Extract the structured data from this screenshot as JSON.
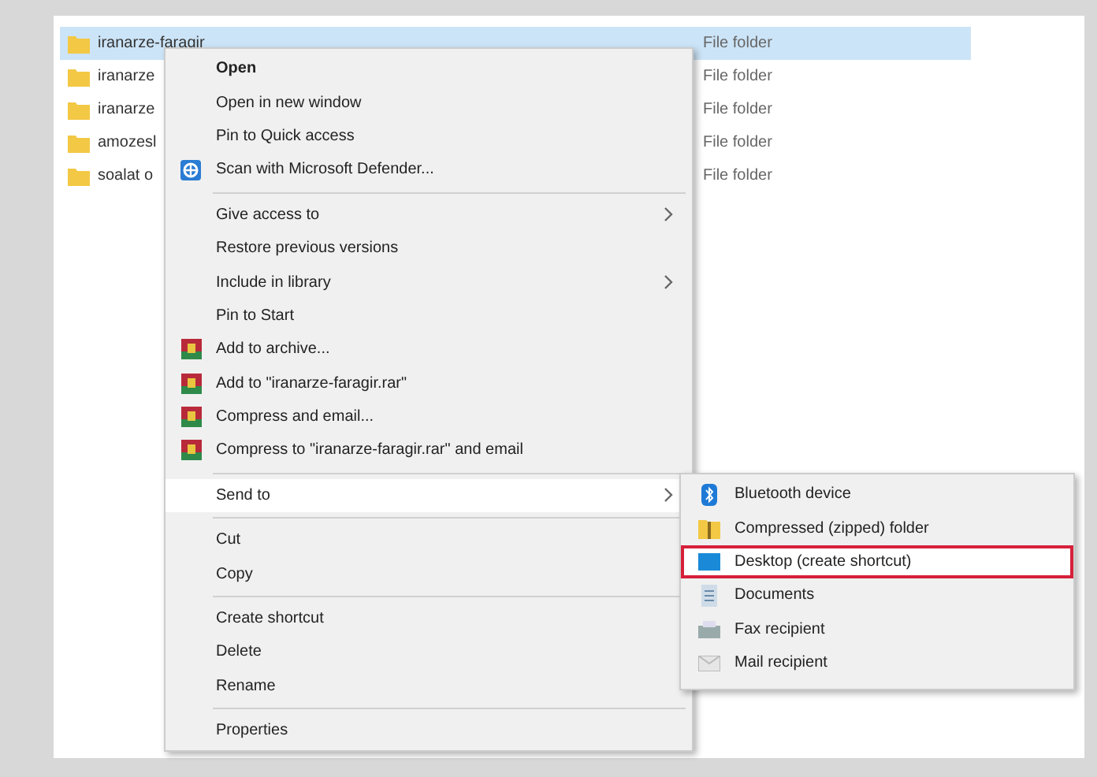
{
  "file_list": {
    "rows": [
      {
        "name": "iranarze-faragir",
        "type": "File folder",
        "selected": true
      },
      {
        "name": "iranarze",
        "type": "File folder",
        "selected": false
      },
      {
        "name": "iranarze",
        "type": "File folder",
        "selected": false
      },
      {
        "name": "amozesl",
        "type": "File folder",
        "selected": false
      },
      {
        "name": "soalat o",
        "type": "File folder",
        "selected": false
      }
    ]
  },
  "context_menu": {
    "items": [
      {
        "kind": "item",
        "label": "Open",
        "bold": true
      },
      {
        "kind": "item",
        "label": "Open in new window"
      },
      {
        "kind": "item",
        "label": "Pin to Quick access"
      },
      {
        "kind": "shield",
        "label": "Scan with Microsoft Defender..."
      },
      {
        "kind": "separator"
      },
      {
        "kind": "item",
        "label": "Give access to",
        "submenu": true
      },
      {
        "kind": "item",
        "label": "Restore previous versions"
      },
      {
        "kind": "item",
        "label": "Include in library",
        "submenu": true
      },
      {
        "kind": "item",
        "label": "Pin to Start"
      },
      {
        "kind": "archive",
        "label": "Add to archive..."
      },
      {
        "kind": "archive",
        "label": "Add to \"iranarze-faragir.rar\""
      },
      {
        "kind": "archive",
        "label": "Compress and email..."
      },
      {
        "kind": "archive",
        "label": "Compress to \"iranarze-faragir.rar\" and email"
      },
      {
        "kind": "separator"
      },
      {
        "kind": "item",
        "label": "Send to",
        "submenu": true,
        "selected": true
      },
      {
        "kind": "separator"
      },
      {
        "kind": "item",
        "label": "Cut"
      },
      {
        "kind": "item",
        "label": "Copy"
      },
      {
        "kind": "separator"
      },
      {
        "kind": "item",
        "label": "Create shortcut"
      },
      {
        "kind": "item",
        "label": "Delete"
      },
      {
        "kind": "item",
        "label": "Rename"
      },
      {
        "kind": "separator"
      },
      {
        "kind": "item",
        "label": "Properties"
      }
    ]
  },
  "send_to_menu": {
    "items": [
      {
        "kind": "bluetooth",
        "label": "Bluetooth device",
        "highlighted": false
      },
      {
        "kind": "zip",
        "label": "Compressed (zipped) folder",
        "highlighted": false
      },
      {
        "kind": "desktop",
        "label": "Desktop (create shortcut)",
        "highlighted": true
      },
      {
        "kind": "documents",
        "label": "Documents",
        "highlighted": false
      },
      {
        "kind": "fax",
        "label": "Fax recipient",
        "highlighted": false
      },
      {
        "kind": "mail",
        "label": "Mail recipient",
        "highlighted": false
      }
    ]
  }
}
